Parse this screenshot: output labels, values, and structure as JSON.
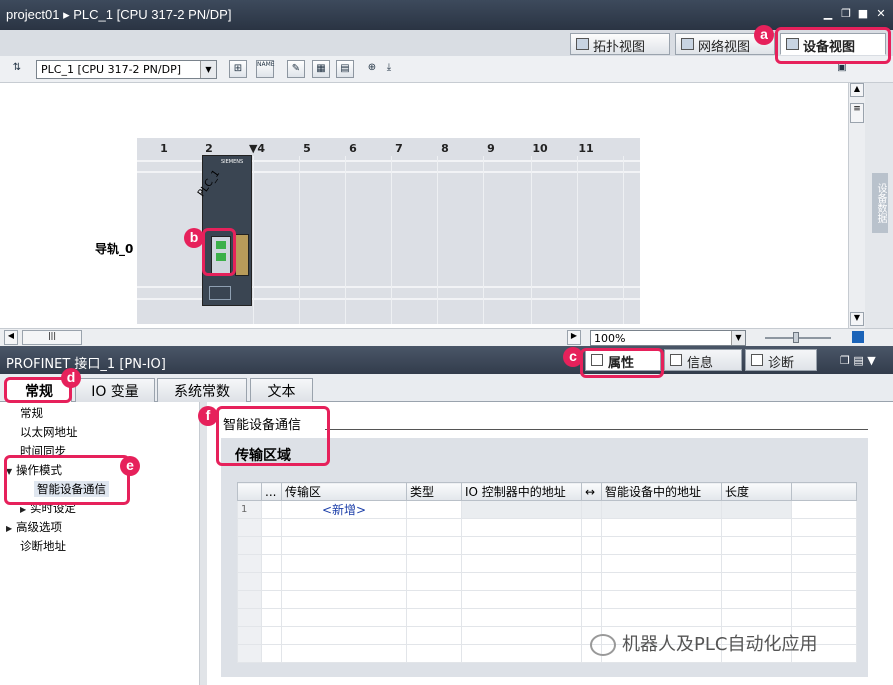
{
  "window": {
    "title": "project01 ▸ PLC_1 [CPU 317-2 PN/DP]"
  },
  "view_tabs": [
    {
      "label": "拓扑视图",
      "icon": "topology-view-icon"
    },
    {
      "label": "网络视图",
      "icon": "network-view-icon"
    },
    {
      "label": "设备视图",
      "icon": "device-view-icon",
      "active": true
    }
  ],
  "toolbar": {
    "device_select": "PLC_1 [CPU 317-2 PN/DP]",
    "name_label": "NAME"
  },
  "canvas": {
    "plc_label": "PLC_1",
    "rail_label": "导轨_0",
    "slot_numbers": [
      "1",
      "2",
      "▼4",
      "5",
      "6",
      "7",
      "8",
      "9",
      "10",
      "11"
    ],
    "cpu_brand": "SIEMENS"
  },
  "side_panel": {
    "label": "设备数据"
  },
  "bottom_bar": {
    "zoom": "100%"
  },
  "inspector": {
    "title": "PROFINET 接口_1 [PN-IO]",
    "tabs": [
      {
        "label": "属性",
        "active": true
      },
      {
        "label": "信息"
      },
      {
        "label": "诊断"
      }
    ],
    "subtabs": [
      "常规",
      "IO 变量",
      "系统常数",
      "文本"
    ],
    "nav_items": [
      "常规",
      "以太网地址",
      "时间同步",
      "操作模式",
      "智能设备通信",
      "实时设定",
      "高级选项",
      "诊断地址"
    ],
    "section_header": "智能设备通信",
    "group_header": "传输区域",
    "table": {
      "columns": [
        "...",
        "传输区",
        "类型",
        "IO 控制器中的地址",
        "↔",
        "智能设备中的地址",
        "长度"
      ],
      "rows": [
        {
          "num": "1",
          "area": "<新增>"
        }
      ]
    }
  },
  "annotations": [
    "a",
    "b",
    "c",
    "d",
    "e",
    "f"
  ],
  "watermark": "机器人及PLC自动化应用",
  "colors": {
    "annotation": "#e6215b",
    "title_bar": "#2a3443",
    "cpu_port_led": "#3cb04a"
  }
}
